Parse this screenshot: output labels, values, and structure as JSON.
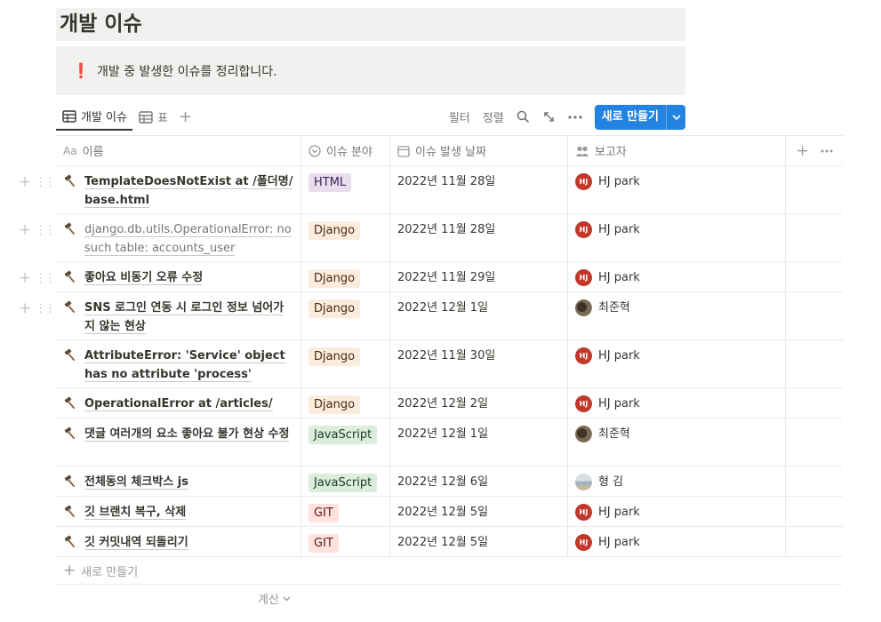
{
  "page": {
    "title": "개발 이슈",
    "callout_icon": "❗",
    "callout_text": "개발 중 발생한 이슈를 정리합니다."
  },
  "toolbar": {
    "views": [
      {
        "label": "개발 이슈",
        "icon": "table-icon",
        "active": true
      },
      {
        "label": "표",
        "icon": "table-icon",
        "active": false
      }
    ],
    "filter_label": "필터",
    "sort_label": "정렬",
    "new_label": "새로 만들기"
  },
  "table": {
    "columns": [
      {
        "label": "이름",
        "icon": "text-type-icon"
      },
      {
        "label": "이슈 분야",
        "icon": "select-icon"
      },
      {
        "label": "이슈 발생 날짜",
        "icon": "calendar-icon"
      },
      {
        "label": "보고자",
        "icon": "people-icon"
      }
    ],
    "rows": [
      {
        "name": "TemplateDoesNotExist at /폴더명/ base.html",
        "category": "HTML",
        "date": "2022년 11월 28일",
        "reporter": "HJ park",
        "avatar": "HJ"
      },
      {
        "name": "django.db.utils.OperationalError: no such table: accounts_user",
        "category": "Django",
        "date": "2022년 11월 28일",
        "reporter": "HJ park",
        "avatar": "HJ"
      },
      {
        "name": "좋아요 비동기 오류 수정",
        "category": "Django",
        "date": "2022년 11월 29일",
        "reporter": "HJ park",
        "avatar": "HJ"
      },
      {
        "name": "SNS 로그인 연동 시 로그인 정보 넘어가지 않는 현상",
        "category": "Django",
        "date": "2022년 12월 1일",
        "reporter": "최준혁",
        "avatar": ""
      },
      {
        "name": "AttributeError: 'Service' object has no attribute 'process'",
        "category": "Django",
        "date": "2022년 11월 30일",
        "reporter": "HJ park",
        "avatar": "HJ"
      },
      {
        "name": "OperationalError at /articles/",
        "category": "Django",
        "date": "2022년 12월 2일",
        "reporter": "HJ park",
        "avatar": "HJ"
      },
      {
        "name": "댓글 여러개의 요소 좋아요 불가 현상 수정",
        "category": "JavaScript",
        "date": "2022년 12월 1일",
        "reporter": "최준혁",
        "avatar": ""
      },
      {
        "name": "전체동의 체크박스 js",
        "category": "JavaScript",
        "date": "2022년 12월 6일",
        "reporter": "형 김",
        "avatar": ""
      },
      {
        "name": "깃 브랜치 복구, 삭제",
        "category": "GIT",
        "date": "2022년 12월 5일",
        "reporter": "HJ park",
        "avatar": "HJ"
      },
      {
        "name": "깃 커밋내역 되돌리기",
        "category": "GIT",
        "date": "2022년 12월 5일",
        "reporter": "HJ park",
        "avatar": "HJ"
      }
    ],
    "add_row_label": "새로 만들기",
    "calc_label": "계산"
  },
  "tag_colors": {
    "HTML": {
      "bg": "#e8deee",
      "fg": "#412454"
    },
    "Django": {
      "bg": "#fbecdd",
      "fg": "#49290e"
    },
    "JavaScript": {
      "bg": "#dbeddb",
      "fg": "#1c3829"
    },
    "GIT": {
      "bg": "#ffe2dd",
      "fg": "#5d1715"
    }
  },
  "accent": "#2383e2"
}
